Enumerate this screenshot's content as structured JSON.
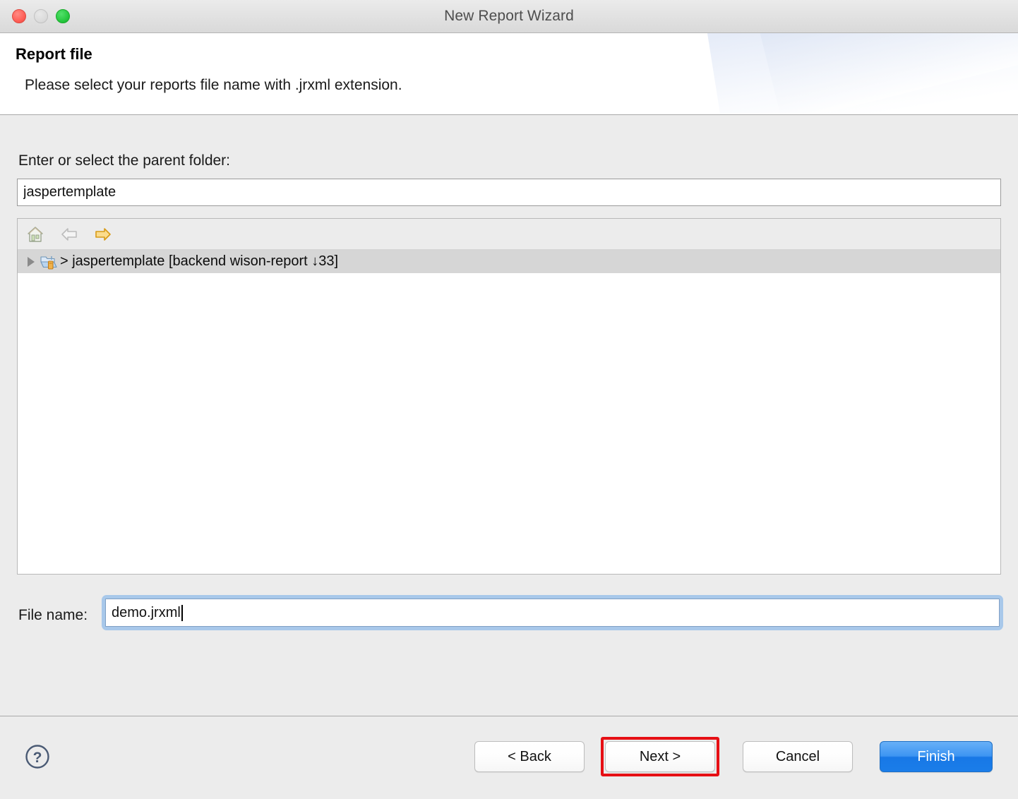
{
  "window": {
    "title": "New Report Wizard",
    "traffic_lights": [
      {
        "name": "close",
        "color": "#ff5f57"
      },
      {
        "name": "minimize",
        "color": "#dcdcdc"
      },
      {
        "name": "maximize",
        "color": "#28c840"
      }
    ]
  },
  "header": {
    "title": "Report file",
    "subtitle": "Please select your reports file name with .jrxml extension."
  },
  "form": {
    "parent_folder_label": "Enter or select the parent folder:",
    "parent_folder_value": "jaspertemplate",
    "parent_folder_placeholder": "",
    "file_name_label": "File name:",
    "file_name_value": "demo.jrxml",
    "file_name_placeholder": ""
  },
  "tree": {
    "toolbar": [
      {
        "icon": "home-icon",
        "enabled": false
      },
      {
        "icon": "back-arrow-icon",
        "enabled": false
      },
      {
        "icon": "forward-arrow-icon",
        "enabled": true,
        "color": "#f5a623"
      }
    ],
    "rows": [
      {
        "icon": "folder-repository-icon",
        "expander": "collapsed-triangle-icon",
        "label": "> jaspertemplate [backend wison-report ↓33]",
        "selected": true
      }
    ]
  },
  "buttons": {
    "help": "?",
    "back": "< Back",
    "next": "Next >",
    "cancel": "Cancel",
    "finish": "Finish"
  },
  "annotation": {
    "target": "next-button",
    "color": "#e60f14"
  }
}
